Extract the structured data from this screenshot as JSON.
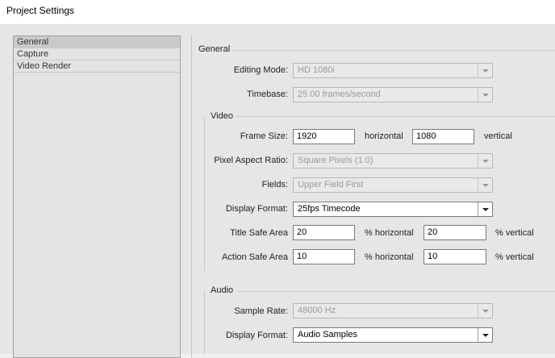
{
  "window": {
    "title": "Project Settings"
  },
  "categories": [
    "General",
    "Capture",
    "Video Render"
  ],
  "general": {
    "section_label": "General",
    "editing_mode": {
      "label": "Editing Mode:",
      "value": "HD 1080i"
    },
    "timebase": {
      "label": "Timebase:",
      "value": "25.00 frames/second"
    }
  },
  "video": {
    "section_label": "Video",
    "frame_size": {
      "label": "Frame Size:",
      "width": "1920",
      "width_unit": "horizontal",
      "height": "1080",
      "height_unit": "vertical"
    },
    "pixel_aspect": {
      "label": "Pixel Aspect Ratio:",
      "value": "Square Pixels (1.0)"
    },
    "fields": {
      "label": "Fields:",
      "value": "Upper Field First"
    },
    "display_format": {
      "label": "Display Format:",
      "value": "25fps Timecode"
    },
    "title_safe": {
      "label": "Title Safe Area",
      "h": "20",
      "h_unit": "% horizontal",
      "v": "20",
      "v_unit": "% vertical"
    },
    "action_safe": {
      "label": "Action Safe Area",
      "h": "10",
      "h_unit": "% horizontal",
      "v": "10",
      "v_unit": "% vertical"
    }
  },
  "audio": {
    "section_label": "Audio",
    "sample_rate": {
      "label": "Sample Rate:",
      "value": "48000 Hz"
    },
    "display_format": {
      "label": "Display Format:",
      "value": "Audio Samples"
    }
  }
}
